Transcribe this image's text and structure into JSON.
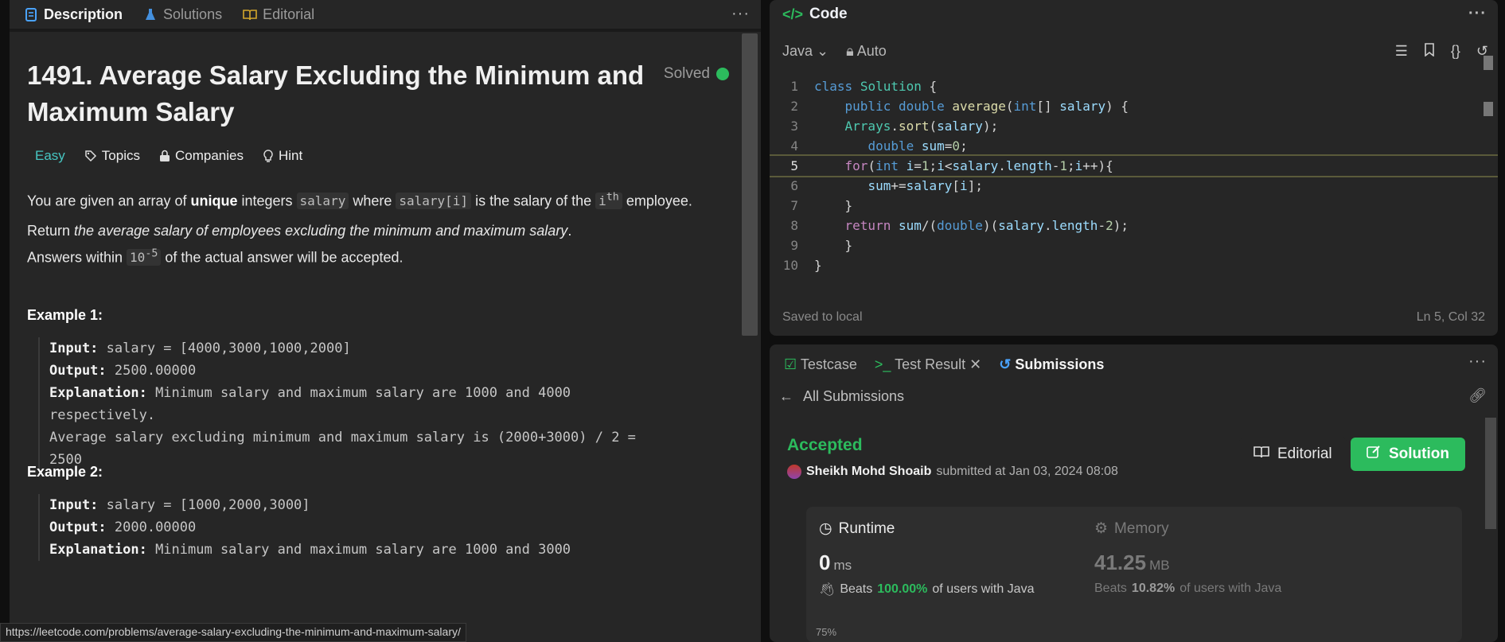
{
  "left": {
    "tabs": [
      {
        "label": "Description",
        "icon": "document-icon"
      },
      {
        "label": "Solutions",
        "icon": "flask-icon"
      },
      {
        "label": "Editorial",
        "icon": "book-icon"
      }
    ],
    "more": "···",
    "title": "1491. Average Salary Excluding the Minimum and Maximum Salary",
    "solved": "Solved",
    "tags": {
      "difficulty": "Easy",
      "topics": "Topics",
      "companies": "Companies",
      "hint": "Hint"
    },
    "p1": {
      "a": "You are given an array of ",
      "b": "unique",
      "c": " integers ",
      "code1": "salary",
      "d": " where ",
      "code2": "salary[i]",
      "e": " is the salary of the ",
      "code3": "i",
      "sup": "th",
      "f": " employee."
    },
    "p2": {
      "a": "Return ",
      "i": "the average salary of employees excluding the minimum and maximum salary",
      "b": ". Answers within ",
      "code": "10",
      "sup": "-5",
      "c": " of the actual answer will be accepted."
    },
    "ex1": {
      "heading": "Example 1:",
      "input_label": "Input:",
      "input": " salary = [4000,3000,1000,2000]",
      "output_label": "Output:",
      "output": " 2500.00000",
      "expl_label": "Explanation:",
      "expl1": " Minimum salary and maximum salary are 1000 and 4000",
      "expl2": "respectively.",
      "expl3": "Average salary excluding minimum and maximum salary is (2000+3000) / 2 =",
      "expl4": "2500"
    },
    "ex2": {
      "heading": "Example 2:",
      "input_label": "Input:",
      "input": " salary = [1000,2000,3000]",
      "output_label": "Output:",
      "output": " 2000.00000",
      "expl_label": "Explanation:",
      "expl1": " Minimum salary and maximum salary are 1000 and 3000"
    },
    "status_url": "https://leetcode.com/problems/average-salary-excluding-the-minimum-and-maximum-salary/"
  },
  "code": {
    "title": "Code",
    "language": "Java",
    "mode": "Auto",
    "lines": [
      "1",
      "2",
      "3",
      "4",
      "5",
      "6",
      "7",
      "8",
      "9",
      "10"
    ],
    "saved": "Saved to local",
    "cursor": "Ln 5, Col 32"
  },
  "bottom": {
    "tabs": {
      "testcase": "Testcase",
      "result": "Test Result",
      "submissions": "Submissions"
    },
    "all": "All Submissions",
    "status": "Accepted",
    "author": "Sheikh Mohd Shoaib",
    "submitted": "submitted at Jan 03, 2024 08:08",
    "editorial_btn": "Editorial",
    "solution_btn": "Solution",
    "runtime": {
      "label": "Runtime",
      "value": "0",
      "unit": "ms",
      "beats": "Beats",
      "pct": "100.00%",
      "suffix": "of users with Java"
    },
    "memory": {
      "label": "Memory",
      "value": "41.25",
      "unit": "MB",
      "beats": "Beats",
      "pct": "10.82%",
      "suffix": "of users with Java"
    },
    "axis_label": "75%"
  },
  "colors": {
    "accent_green": "#2cbb5d",
    "easy": "#46c6c2",
    "link_blue": "#4aa3ff"
  }
}
